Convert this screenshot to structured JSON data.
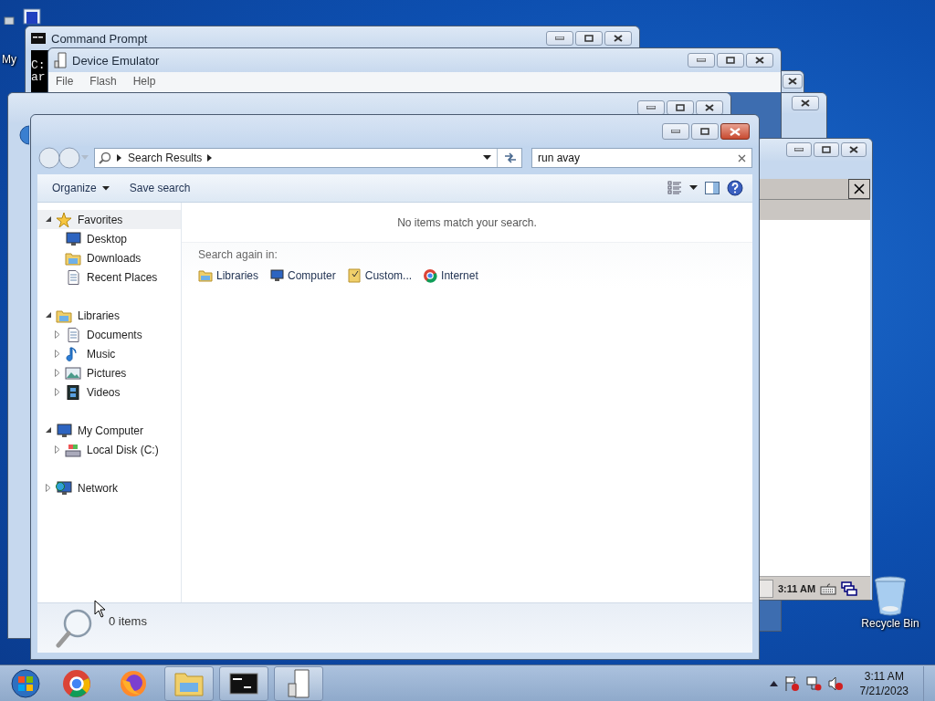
{
  "desktop": {
    "icons": [
      {
        "label": "My",
        "kind": "computer"
      },
      {
        "label": "Recycle Bin",
        "kind": "bin"
      }
    ]
  },
  "command_prompt": {
    "title": "Command Prompt",
    "console_lines": [
      "C:",
      "ar"
    ]
  },
  "device_emulator": {
    "title": "Device Emulator",
    "menu": [
      "File",
      "Flash",
      "Help"
    ]
  },
  "emulator_screen": {
    "clock": "3:11 AM"
  },
  "explorer": {
    "breadcrumb": [
      "Search Results"
    ],
    "search": {
      "value": "run avay"
    },
    "toolbar": [
      {
        "label": "Organize",
        "kind": "menu"
      },
      {
        "label": "Save search",
        "kind": "button"
      }
    ],
    "navigation": [
      {
        "label": "Favorites",
        "kind": "star",
        "expanded": true,
        "selected": true,
        "children": [
          {
            "label": "Desktop",
            "kind": "desktop",
            "selected": false
          },
          {
            "label": "Downloads",
            "kind": "downloads",
            "selected": false
          },
          {
            "label": "Recent Places",
            "kind": "recent",
            "selected": false
          }
        ]
      },
      {
        "label": "Libraries",
        "kind": "library",
        "expanded": true,
        "selected": false,
        "children": [
          {
            "label": "Documents",
            "kind": "documents",
            "expanded": false,
            "selected": false
          },
          {
            "label": "Music",
            "kind": "music",
            "expanded": false,
            "selected": false
          },
          {
            "label": "Pictures",
            "kind": "pictures",
            "expanded": false,
            "selected": false
          },
          {
            "label": "Videos",
            "kind": "videos",
            "expanded": false,
            "selected": false
          }
        ]
      },
      {
        "label": "My Computer",
        "kind": "computer",
        "expanded": true,
        "selected": false,
        "children": [
          {
            "label": "Local Disk (C:)",
            "kind": "disk",
            "expanded": false,
            "selected": false
          }
        ]
      },
      {
        "label": "Network",
        "kind": "network",
        "expanded": false,
        "selected": false
      }
    ],
    "message": "No items match your search.",
    "search_again": {
      "label": "Search again in:",
      "locations": [
        {
          "label": "Libraries",
          "kind": "library"
        },
        {
          "label": "Computer",
          "kind": "computer"
        },
        {
          "label": "Custom...",
          "kind": "custom"
        },
        {
          "label": "Internet",
          "kind": "internet"
        }
      ]
    },
    "status": "0 items"
  },
  "taskbar": {
    "buttons": [
      {
        "kind": "start",
        "active": false
      },
      {
        "kind": "chrome",
        "active": false
      },
      {
        "kind": "firefox",
        "active": false
      },
      {
        "kind": "explorer",
        "active": true
      },
      {
        "kind": "console",
        "active": true
      },
      {
        "kind": "emulator",
        "active": true
      }
    ],
    "time": "3:11 AM",
    "date": "7/21/2023"
  }
}
